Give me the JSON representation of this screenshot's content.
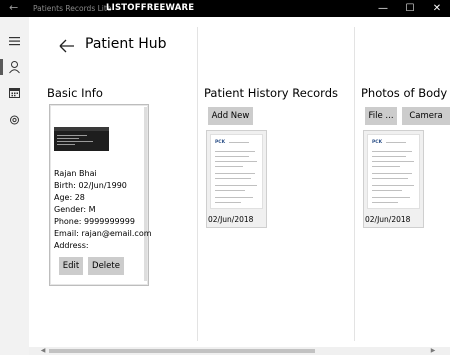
{
  "titlebar": {
    "app_title": "Patients Records Lite",
    "overlay_text": "LISTOFFREEWARE",
    "back_glyph": "←",
    "minimize_glyph": "—",
    "maximize_glyph": "☐",
    "close_glyph": "✕"
  },
  "nav": {
    "items": [
      {
        "icon": "hamburger-menu-icon"
      },
      {
        "icon": "person-icon",
        "selected": true
      },
      {
        "icon": "calendar-icon"
      },
      {
        "icon": "settings-gear-icon"
      }
    ]
  },
  "page": {
    "title": "Patient Hub",
    "back_icon": "back-arrow-icon"
  },
  "basic_info": {
    "heading": "Basic Info",
    "name": "Rajan Bhai",
    "birth": "Birth: 02/Jun/1990",
    "age": "Age: 28",
    "gender": "Gender: M",
    "phone": "Phone: 9999999999",
    "email": "Email: rajan@email.com",
    "address": "Address:",
    "edit_label": "Edit",
    "delete_label": "Delete"
  },
  "history": {
    "heading": "Patient History Records",
    "add_label": "Add New",
    "records": [
      {
        "date": "02/Jun/2018",
        "logo": "PCK"
      }
    ]
  },
  "photos": {
    "heading": "Photos of Body",
    "file_label": "File ...",
    "camera_label": "Camera",
    "items": [
      {
        "date": "02/Jun/2018",
        "logo": "PCK"
      }
    ]
  },
  "colors": {
    "titlebar_bg": "#000000",
    "nav_bg": "#f2f2f2",
    "button_bg": "#cccccc",
    "divider": "#e3e3e3"
  }
}
